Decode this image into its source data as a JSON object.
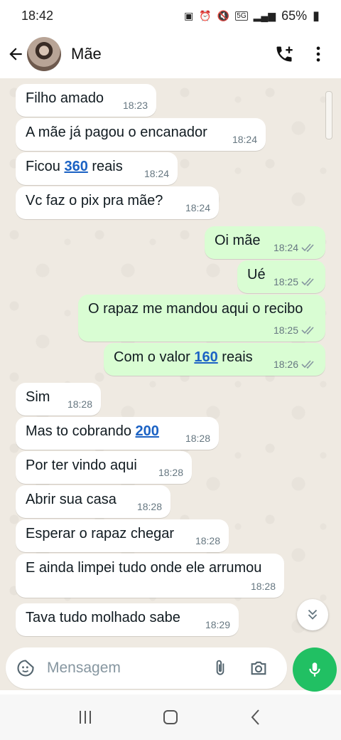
{
  "status": {
    "time": "18:42",
    "battery": "65%",
    "network": "5G"
  },
  "header": {
    "contact_name": "Mãe"
  },
  "messages": [
    {
      "dir": "in",
      "text": "Filho amado",
      "time": "18:23"
    },
    {
      "dir": "in",
      "text": "A mãe já pagou o encanador",
      "time": "18:24"
    },
    {
      "dir": "in",
      "pre": "Ficou ",
      "link": "360",
      "post": " reais",
      "time": "18:24"
    },
    {
      "dir": "in",
      "text": "Vc faz o pix pra mãe?",
      "time": "18:24"
    },
    {
      "dir": "out",
      "text": "Oi mãe",
      "time": "18:24"
    },
    {
      "dir": "out",
      "text": "Ué",
      "time": "18:25"
    },
    {
      "dir": "out",
      "text": "O rapaz me mandou aqui o recibo",
      "time": "18:25"
    },
    {
      "dir": "out",
      "pre": "Com o valor ",
      "link": "160",
      "post": " reais",
      "time": "18:26"
    },
    {
      "dir": "in",
      "text": "Sim",
      "time": "18:28"
    },
    {
      "dir": "in",
      "pre": "Mas to cobrando ",
      "link": "200",
      "post": "",
      "time": "18:28"
    },
    {
      "dir": "in",
      "text": "Por ter vindo aqui",
      "time": "18:28"
    },
    {
      "dir": "in",
      "text": "Abrir sua casa",
      "time": "18:28"
    },
    {
      "dir": "in",
      "text": "Esperar o rapaz chegar",
      "time": "18:28"
    },
    {
      "dir": "in",
      "text": "E ainda limpei tudo onde ele arrumou",
      "time": "18:28"
    },
    {
      "dir": "in",
      "text": "Tava tudo molhado sabe",
      "time": "18:29"
    }
  ],
  "composer": {
    "placeholder": "Mensagem"
  },
  "icons": {
    "back": "arrow-left-icon",
    "call": "add-call-icon",
    "menu": "more-vert-icon",
    "emoji": "sticker-icon",
    "attach": "paperclip-icon",
    "camera": "camera-icon",
    "mic": "mic-icon",
    "jump": "double-chevron-down-icon"
  },
  "colors": {
    "accent": "#21c063",
    "out_bubble": "#d9fdd3",
    "in_bubble": "#ffffff",
    "link": "#1b62c4",
    "chat_bg": "#efeae2"
  }
}
